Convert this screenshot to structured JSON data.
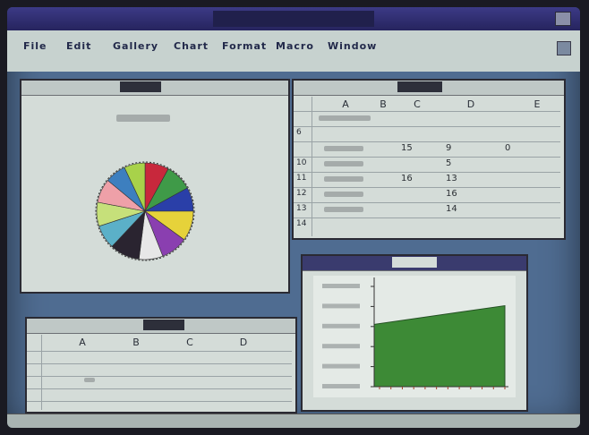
{
  "menu": {
    "items": [
      "File",
      "Edit",
      "Gallery",
      "Chart",
      "Format",
      "Macro",
      "Window"
    ]
  },
  "sheet1": {
    "columns": [
      "A",
      "B",
      "C",
      "D",
      "E"
    ],
    "rows": [
      {
        "num": "",
        "values": [
          "",
          "",
          "",
          ""
        ]
      },
      {
        "num": "6",
        "values": [
          "",
          "",
          "",
          ""
        ]
      },
      {
        "num": "",
        "values": [
          "",
          "15",
          "9",
          "0"
        ]
      },
      {
        "num": "10",
        "values": [
          "",
          "",
          "5",
          ""
        ]
      },
      {
        "num": "11",
        "values": [
          "",
          "16",
          "13",
          ""
        ]
      },
      {
        "num": "12",
        "values": [
          "",
          "",
          "16",
          ""
        ]
      },
      {
        "num": "13",
        "values": [
          "",
          "",
          "14",
          ""
        ]
      },
      {
        "num": "14",
        "values": [
          "",
          "",
          "",
          ""
        ]
      }
    ]
  },
  "sheet2": {
    "columns": [
      "A",
      "B",
      "C",
      "D"
    ]
  },
  "chart_data": [
    {
      "type": "pie",
      "title": "",
      "slice_colors": [
        "#c8283c",
        "#3f9a48",
        "#2a3fa8",
        "#e6d23a",
        "#8a3fb0",
        "#e7e7e7",
        "#2a2430",
        "#5bb0c8",
        "#c6e07a",
        "#eea0a8",
        "#3d7fbf",
        "#a8d24a"
      ],
      "values": [
        8,
        9,
        8,
        10,
        9,
        8,
        10,
        8,
        8,
        8,
        7,
        7
      ]
    },
    {
      "type": "area",
      "title": "",
      "x": [
        0,
        1
      ],
      "values": [
        0.6,
        0.78
      ],
      "color": "#3d8a36",
      "ylim": [
        0,
        1
      ]
    }
  ]
}
